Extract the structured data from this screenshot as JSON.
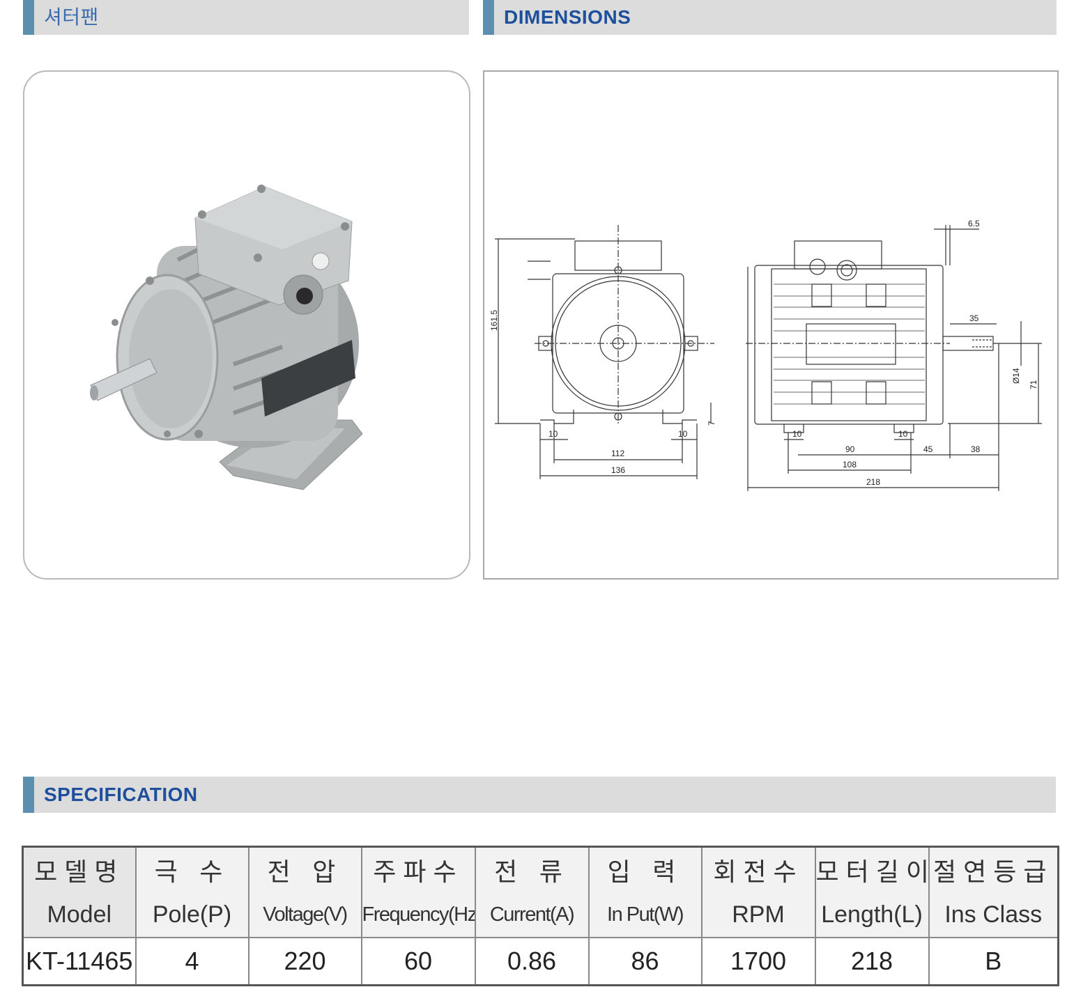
{
  "sections": {
    "product_title": "셔터팬",
    "dimensions_title": "DIMENSIONS",
    "specification_title": "SPECIFICATION"
  },
  "drawing": {
    "front_view": {
      "height": "161.5",
      "base_height": "7",
      "foot_left": "10",
      "foot_right": "10",
      "hole_span": "112",
      "base_width": "136"
    },
    "side_view": {
      "shaft_top_offset": "6.5",
      "shaft_length": "35",
      "shaft_diameter": "Ø14",
      "shaft_height": "71",
      "foot_left": "10",
      "foot_right": "10",
      "hole_span": "90",
      "foot_span": "108",
      "shaft_offset": "45",
      "shaft_extension": "38",
      "total_length": "218"
    }
  },
  "spec": {
    "columns": [
      {
        "ko": "모델명",
        "en": "Model"
      },
      {
        "ko": "극 수",
        "en": "Pole(P)"
      },
      {
        "ko": "전 압",
        "en": "Voltage(V)"
      },
      {
        "ko": "주파수",
        "en": "Frequency(Hz)"
      },
      {
        "ko": "전 류",
        "en": "Current(A)"
      },
      {
        "ko": "입 력",
        "en": "In Put(W)"
      },
      {
        "ko": "회전수",
        "en": "RPM"
      },
      {
        "ko": "모터길이",
        "en": "Length(L)"
      },
      {
        "ko": "절연등급",
        "en": "Ins Class"
      }
    ],
    "row": [
      "KT-11465",
      "4",
      "220",
      "60",
      "0.86",
      "86",
      "1700",
      "218",
      "B"
    ]
  },
  "colors": {
    "accent_bar": "#5a8fb0",
    "section_title": "#1d4f9c",
    "section_bg": "#dcdcdc",
    "motor_body": "#b8bcbc"
  },
  "product_image": "motor-photo"
}
